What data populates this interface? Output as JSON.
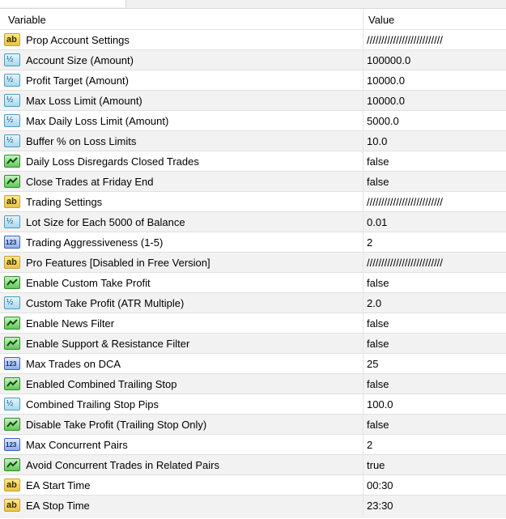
{
  "header": {
    "variable_label": "Variable",
    "value_label": "Value"
  },
  "rows": [
    {
      "type": "text",
      "name": "Prop Account Settings",
      "value": "//////////////////////////"
    },
    {
      "type": "double",
      "name": "Account Size (Amount)",
      "value": "100000.0"
    },
    {
      "type": "double",
      "name": "Profit Target (Amount)",
      "value": "10000.0"
    },
    {
      "type": "double",
      "name": "Max Loss Limit (Amount)",
      "value": "10000.0"
    },
    {
      "type": "double",
      "name": "Max Daily Loss Limit (Amount)",
      "value": "5000.0"
    },
    {
      "type": "double",
      "name": "Buffer % on Loss Limits",
      "value": "10.0"
    },
    {
      "type": "bool",
      "name": "Daily Loss Disregards Closed Trades",
      "value": "false"
    },
    {
      "type": "bool",
      "name": "Close Trades at Friday End",
      "value": "false"
    },
    {
      "type": "text",
      "name": "Trading Settings",
      "value": "//////////////////////////"
    },
    {
      "type": "double",
      "name": "Lot Size for Each 5000 of Balance",
      "value": "0.01"
    },
    {
      "type": "int",
      "name": "Trading Aggressiveness (1-5)",
      "value": "2"
    },
    {
      "type": "text",
      "name": "Pro Features [Disabled in Free Version]",
      "value": "//////////////////////////"
    },
    {
      "type": "bool",
      "name": "Enable Custom Take Profit",
      "value": "false"
    },
    {
      "type": "double",
      "name": "Custom Take Profit (ATR Multiple)",
      "value": "2.0"
    },
    {
      "type": "bool",
      "name": "Enable News Filter",
      "value": "false"
    },
    {
      "type": "bool",
      "name": "Enable Support & Resistance Filter",
      "value": "false"
    },
    {
      "type": "int",
      "name": "Max Trades  on DCA",
      "value": "25"
    },
    {
      "type": "bool",
      "name": "Enabled Combined Trailing Stop",
      "value": "false"
    },
    {
      "type": "double",
      "name": "Combined Trailing Stop Pips",
      "value": "100.0"
    },
    {
      "type": "bool",
      "name": "Disable Take Profit (Trailing Stop Only)",
      "value": "false"
    },
    {
      "type": "int",
      "name": "Max Concurrent Pairs",
      "value": "2"
    },
    {
      "type": "bool",
      "name": "Avoid Concurrent Trades in Related Pairs",
      "value": "true"
    },
    {
      "type": "text",
      "name": "EA Start Time",
      "value": "00:30"
    },
    {
      "type": "text",
      "name": "EA Stop Time",
      "value": "23:30"
    }
  ],
  "icons": {
    "text": {
      "name": "string-type-icon",
      "glyph": "ab"
    },
    "double": {
      "name": "double-type-icon",
      "glyph": "½"
    },
    "bool": {
      "name": "bool-type-icon",
      "glyph": ""
    },
    "int": {
      "name": "integer-type-icon",
      "glyph": "123"
    }
  }
}
